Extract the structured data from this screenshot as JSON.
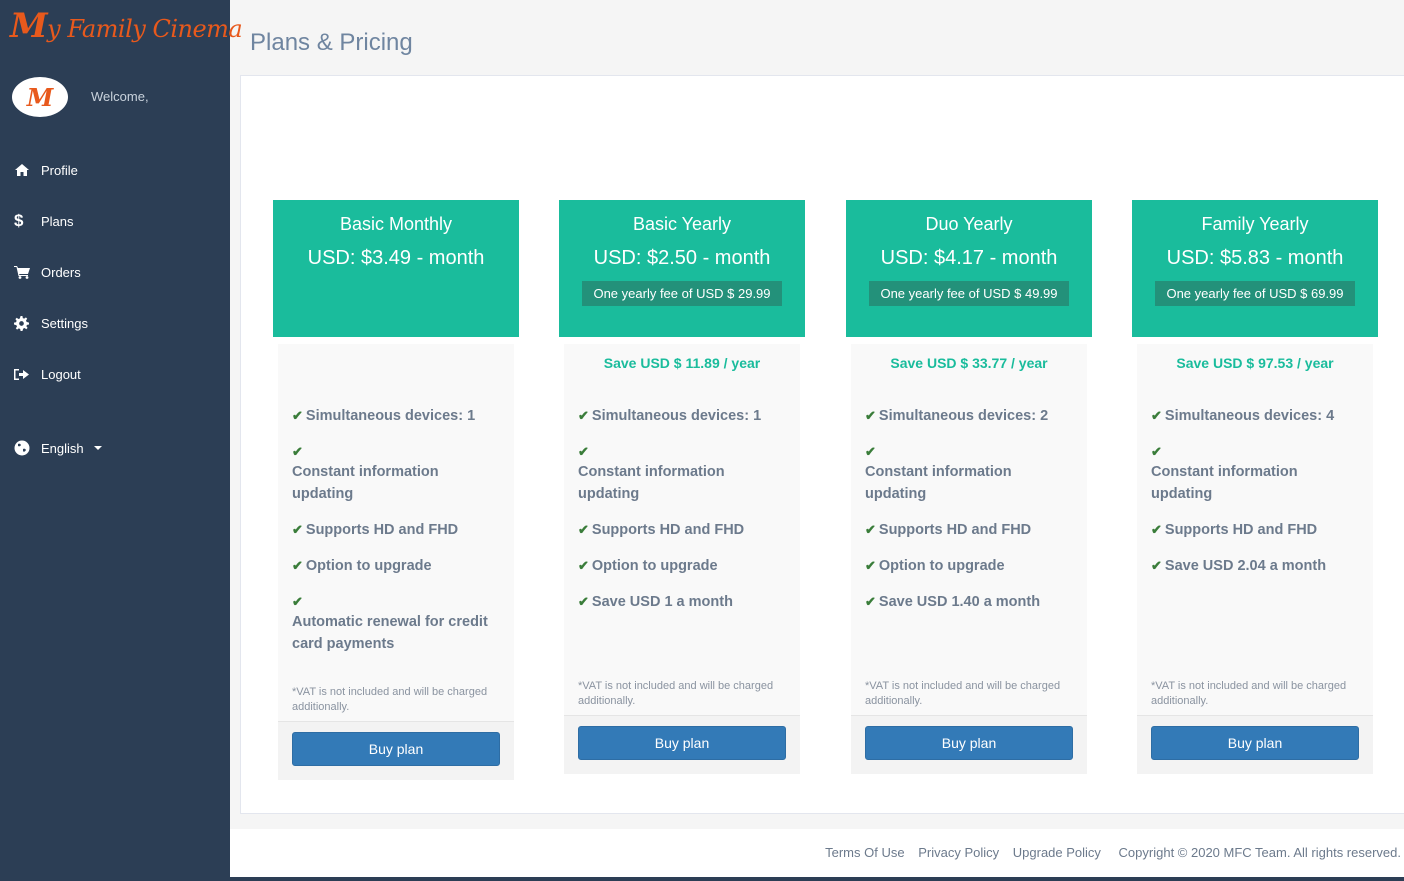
{
  "brand": {
    "logo_initial": "M",
    "logo_rest": "y Family Cinema",
    "avatar_letter": "M",
    "accent": "#e8591c"
  },
  "sidebar": {
    "welcome": "Welcome,",
    "items": [
      {
        "label": "Profile",
        "icon": "home-icon"
      },
      {
        "label": "Plans",
        "icon": "dollar-icon"
      },
      {
        "label": "Orders",
        "icon": "cart-icon"
      },
      {
        "label": "Settings",
        "icon": "gear-icon"
      },
      {
        "label": "Logout",
        "icon": "logout-icon"
      }
    ],
    "language": {
      "label": "English",
      "icon": "globe-icon"
    }
  },
  "page": {
    "title": "Plans & Pricing"
  },
  "plans": [
    {
      "name": "Basic Monthly",
      "price": "USD: $3.49 - month",
      "yearly_fee": "",
      "save_year": "",
      "features": [
        "Simultaneous devices: 1",
        "Constant information updating",
        "Supports HD and FHD",
        "Option to upgrade",
        "Automatic renewal for credit card payments"
      ],
      "vat": "*VAT is not included and will be charged additionally.",
      "button": "Buy plan"
    },
    {
      "name": "Basic Yearly",
      "price": "USD: $2.50 - month",
      "yearly_fee": "One yearly fee of USD $ 29.99",
      "save_year": "Save USD $ 11.89 / year",
      "features": [
        "Simultaneous devices: 1",
        "Constant information updating",
        "Supports HD and FHD",
        "Option to upgrade",
        "Save USD 1 a month"
      ],
      "vat": "*VAT is not included and will be charged additionally.",
      "button": "Buy plan"
    },
    {
      "name": "Duo Yearly",
      "price": "USD: $4.17 - month",
      "yearly_fee": "One yearly fee of USD $ 49.99",
      "save_year": "Save USD $ 33.77 / year",
      "features": [
        "Simultaneous devices: 2",
        "Constant information updating",
        "Supports HD and FHD",
        "Option to upgrade",
        "Save USD 1.40 a month"
      ],
      "vat": "*VAT is not included and will be charged additionally.",
      "button": "Buy plan"
    },
    {
      "name": "Family Yearly",
      "price": "USD: $5.83 - month",
      "yearly_fee": "One yearly fee of USD $ 69.99",
      "save_year": "Save USD $ 97.53 / year",
      "features": [
        "Simultaneous devices: 4",
        "Constant information updating",
        "Supports HD and FHD",
        "Save USD 2.04 a month"
      ],
      "vat": "*VAT is not included and will be charged additionally.",
      "button": "Buy plan"
    }
  ],
  "footer": {
    "links": [
      "Terms Of Use",
      "Privacy Policy",
      "Upgrade Policy"
    ],
    "copyright": "Copyright © 2020 MFC Team. All rights reserved."
  },
  "colors": {
    "sidebar_bg": "#2c3e55",
    "plan_header": "#1abc9c",
    "button": "#337ab7",
    "check": "#3a7d3a"
  }
}
